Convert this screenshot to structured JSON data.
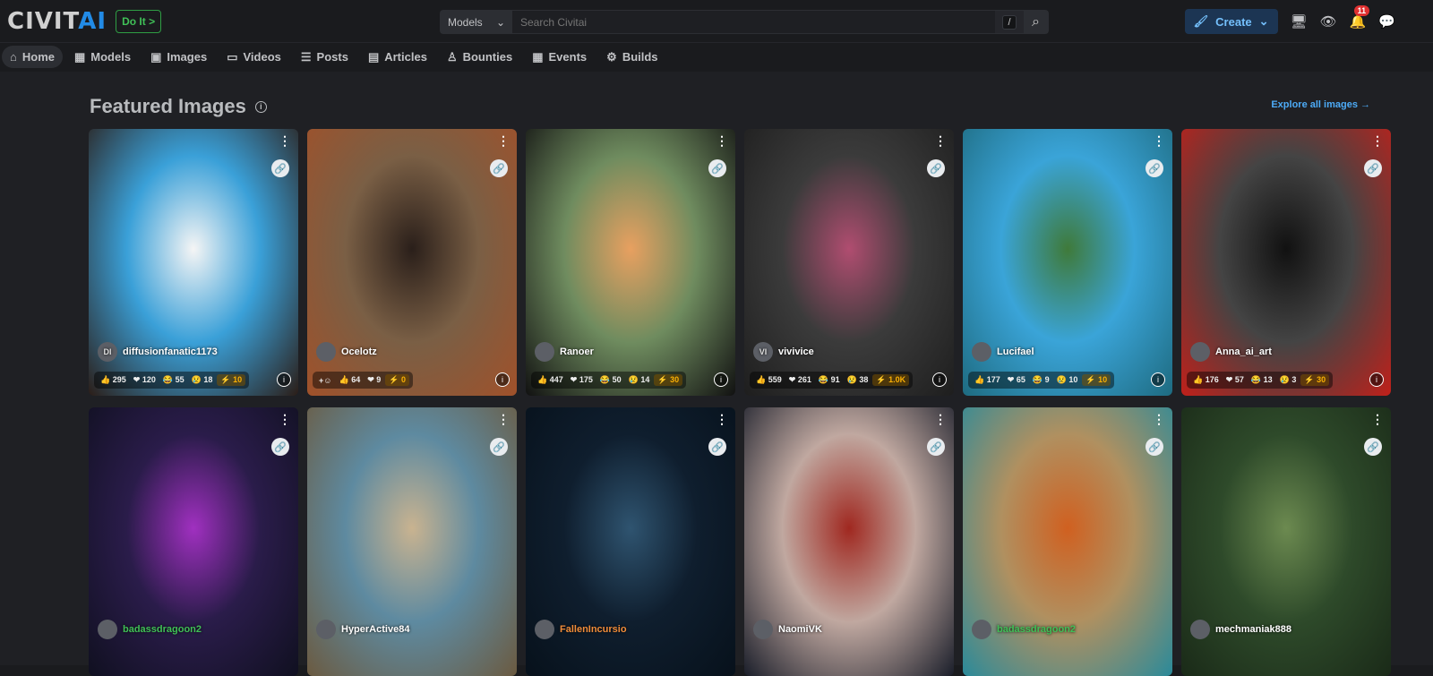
{
  "header": {
    "logo": "CIVITAI",
    "do_it": "Do It >",
    "search_scope": "Models",
    "search_placeholder": "Search Civitai",
    "search_shortcut": "/",
    "create_label": "Create",
    "notification_count": "11"
  },
  "nav": [
    {
      "label": "Home",
      "icon": "home-icon",
      "active": true
    },
    {
      "label": "Models",
      "icon": "models-icon"
    },
    {
      "label": "Images",
      "icon": "image-icon"
    },
    {
      "label": "Videos",
      "icon": "video-icon"
    },
    {
      "label": "Posts",
      "icon": "posts-icon"
    },
    {
      "label": "Articles",
      "icon": "article-icon"
    },
    {
      "label": "Bounties",
      "icon": "bounty-icon"
    },
    {
      "label": "Events",
      "icon": "calendar-icon"
    },
    {
      "label": "Builds",
      "icon": "builds-icon"
    }
  ],
  "section": {
    "title": "Featured Images",
    "explore_label": "Explore all images →"
  },
  "cards": [
    {
      "user": "diffusionfanatic1173",
      "avatar": "DI",
      "reactions": {
        "like": "295",
        "heart": "120",
        "laugh": "55",
        "cry": "18",
        "buzz": "10"
      },
      "colors": [
        "#3aa0d8",
        "#f5f5f5",
        "#2b1d17"
      ]
    },
    {
      "user": "Ocelotz",
      "reactions": {
        "like": "64",
        "heart": "9",
        "buzz": "0"
      },
      "add_reaction": true,
      "colors": [
        "#7a5f45",
        "#2a1f1a",
        "#a0512a"
      ]
    },
    {
      "user": "Ranoer",
      "reactions": {
        "like": "447",
        "heart": "175",
        "laugh": "50",
        "cry": "14",
        "buzz": "30"
      },
      "colors": [
        "#6f8c5f",
        "#e8a060",
        "#111"
      ]
    },
    {
      "user": "vivivice",
      "avatar": "VI",
      "reactions": {
        "like": "559",
        "heart": "261",
        "laugh": "91",
        "cry": "38",
        "buzz": "1.0K"
      },
      "colors": [
        "#3b3b3b",
        "#b04d70",
        "#1e1e1e"
      ]
    },
    {
      "user": "Lucifael",
      "reactions": {
        "like": "177",
        "heart": "65",
        "laugh": "9",
        "cry": "10",
        "buzz": "10"
      },
      "colors": [
        "#3aa4d8",
        "#3f7a3a",
        "#1e6b80"
      ]
    },
    {
      "user": "Anna_ai_art",
      "reactions": {
        "like": "176",
        "heart": "57",
        "laugh": "13",
        "cry": "3",
        "buzz": "30"
      },
      "colors": [
        "#444",
        "#111",
        "#c0201a"
      ]
    },
    {
      "user": "badassdragoon2",
      "user_color": "#40c057",
      "colors": [
        "#2a1c4a",
        "#a030c0",
        "#101020"
      ]
    },
    {
      "user": "HyperActive84",
      "colors": [
        "#5e8aa0",
        "#c9b390",
        "#6b5a40"
      ]
    },
    {
      "user": "FallenIncursio",
      "user_color": "#f08c3a",
      "colors": [
        "#0f1e2e",
        "#2f5470",
        "#07111b"
      ]
    },
    {
      "user": "NaomiVK",
      "colors": [
        "#c0a8a0",
        "#a02820",
        "#1a1e2a"
      ]
    },
    {
      "user": "badassdragoon2",
      "user_color": "#40c057",
      "colors": [
        "#b09060",
        "#d06020",
        "#2a8a9a"
      ]
    },
    {
      "user": "mechmaniak888",
      "colors": [
        "#2e4a2a",
        "#6c8a50",
        "#1a2a18"
      ]
    }
  ]
}
